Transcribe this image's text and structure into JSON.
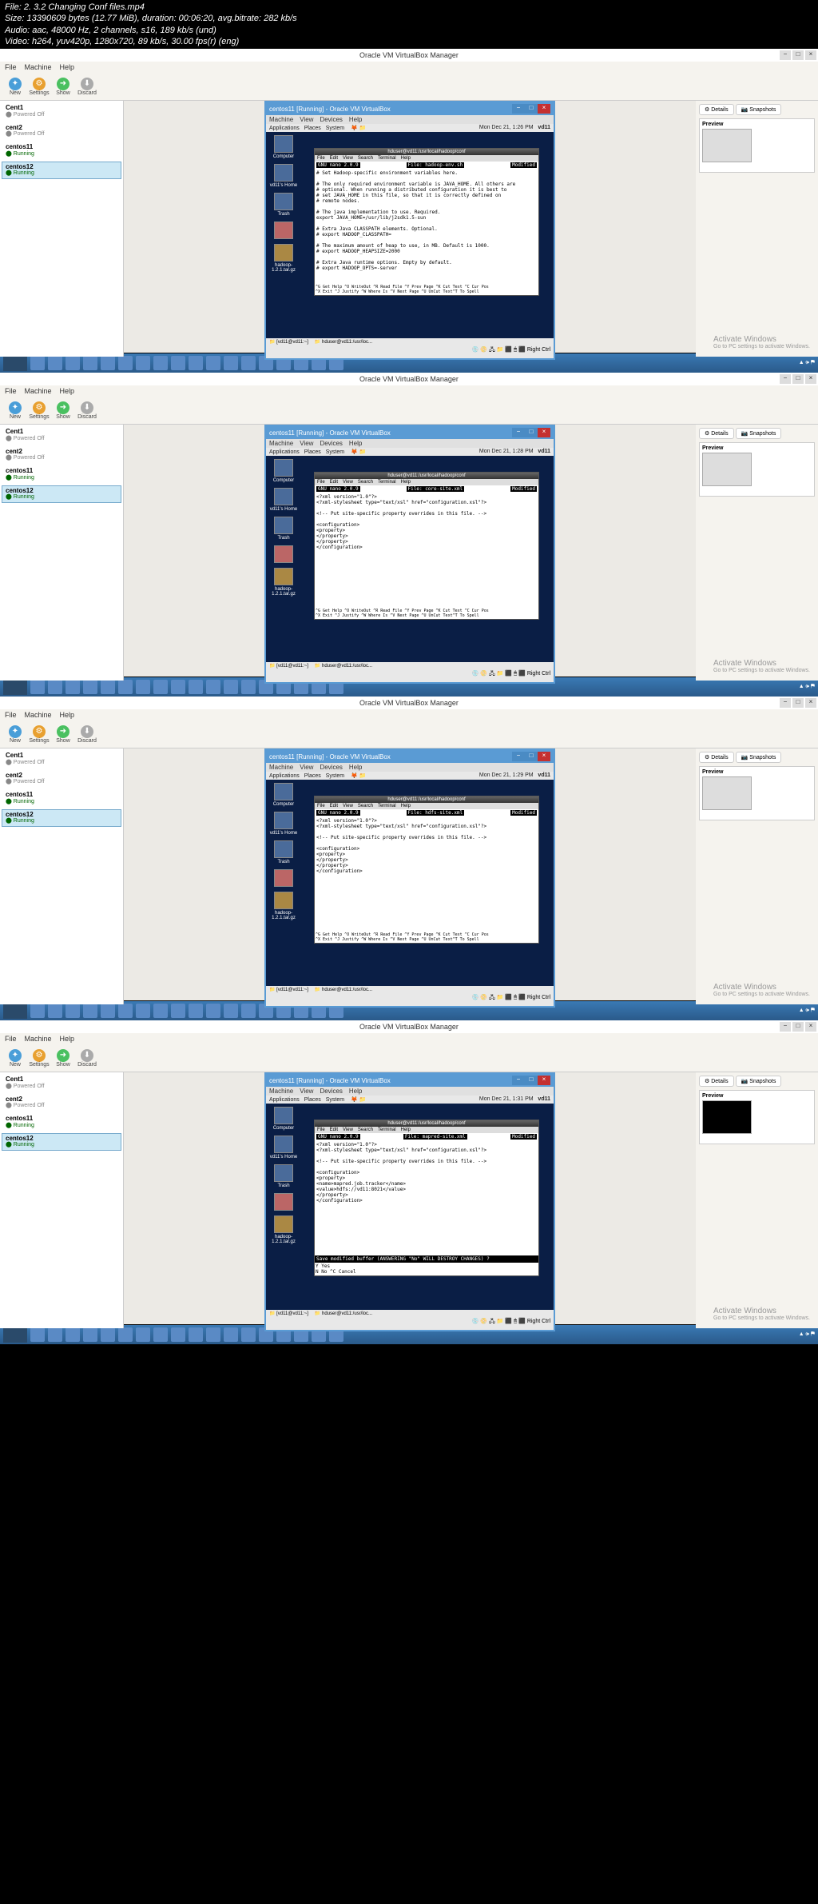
{
  "meta": {
    "file": "File: 2. 3.2 Changing Conf files.mp4",
    "size": "Size: 13390609 bytes (12.77 MiB), duration: 00:06:20, avg.bitrate: 282 kb/s",
    "audio": "Audio: aac, 48000 Hz, 2 channels, s16, 189 kb/s (und)",
    "video": "Video: h264, yuv420p, 1280x720, 89 kb/s, 30.00 fps(r) (eng)"
  },
  "vbox": {
    "title": "Oracle VM VirtualBox Manager",
    "menu": [
      "File",
      "Machine",
      "Help"
    ],
    "tools": {
      "new": "New",
      "settings": "Settings",
      "show": "Show",
      "discard": "Discard"
    },
    "tabs": {
      "details": "Details",
      "snapshots": "Snapshots"
    },
    "preview": "Preview",
    "vms": [
      {
        "name": "Cent1",
        "state": "Powered Off"
      },
      {
        "name": "cent2",
        "state": "Powered Off"
      },
      {
        "name": "centos11",
        "state": "Running"
      },
      {
        "name": "centos12",
        "state": "Running"
      }
    ]
  },
  "guest": {
    "menu": [
      "Machine",
      "View",
      "Devices",
      "Help"
    ],
    "gnome_menu": [
      "Applications",
      "Places",
      "System"
    ],
    "user": "vd11",
    "icons": {
      "computer": "Computer",
      "home": "vd11's Home",
      "trash": "Trash",
      "hadoop": "hadoop-1.2.1.tar.gz"
    },
    "term_menu": [
      "File",
      "Edit",
      "View",
      "Search",
      "Terminal",
      "Help"
    ],
    "nano_ver": "GNU nano 2.0.9",
    "modified": "Modified",
    "task1": "[vd11@vd11:~]",
    "task2": "hduser@vd11:/usr/loc...",
    "statusbar": "Right Ctrl"
  },
  "shots": [
    {
      "title": "centos11 [Running] - Oracle VM VirtualBox",
      "time": "Mon Dec 21, 1:26 PM",
      "term_title": "hduser@vd11:/usr/local/hadoop/conf",
      "nano_file": "File: hadoop-env.sh",
      "content": "# Set Hadoop-specific environment variables here.\n\n# The only required environment variable is JAVA_HOME. All others are\n# optional. When running a distributed configuration it is best to\n# set JAVA_HOME in this file, so that it is correctly defined on\n# remote nodes.\n\n# The java implementation to use. Required.\nexport JAVA_HOME=/usr/lib/j2sdk1.5-sun\n\n# Extra Java CLASSPATH elements. Optional.\n# export HADOOP_CLASSPATH=\n\n# The maximum amount of heap to use, in MB. Default is 1000.\n# export HADOOP_HEAPSIZE=2000\n\n# Extra Java runtime options. Empty by default.\n# export HADOOP_OPTS=-server"
    },
    {
      "title": "centos11 [Running] - Oracle VM VirtualBox",
      "time": "Mon Dec 21, 1:28 PM",
      "term_title": "hduser@vd11:/usr/local/hadoop/conf",
      "nano_file": "File: core-site.xml",
      "content": "<?xml version=\"1.0\"?>\n<?xml-stylesheet type=\"text/xsl\" href=\"configuration.xsl\"?>\n\n<!-- Put site-specific property overrides in this file. -->\n\n<configuration>\n<property>\n</property>\n</property>\n</configuration>"
    },
    {
      "title": "centos11 [Running] - Oracle VM VirtualBox",
      "time": "Mon Dec 21, 1:29 PM",
      "term_title": "hduser@vd11:/usr/local/hadoop/conf",
      "nano_file": "File: hdfs-site.xml",
      "content": "<?xml version=\"1.0\"?>\n<?xml-stylesheet type=\"text/xsl\" href=\"configuration.xsl\"?>\n\n<!-- Put site-specific property overrides in this file. -->\n\n<configuration>\n<property>\n</property>\n</property>\n</configuration>"
    },
    {
      "title": "centos11 [Running] - Oracle VM VirtualBox",
      "time": "Mon Dec 21, 1:31 PM",
      "term_title": "hduser@vd11:/usr/local/hadoop/conf",
      "nano_file": "File: mapred-site.xml",
      "content": "<?xml version=\"1.0\"?>\n<?xml-stylesheet type=\"text/xsl\" href=\"configuration.xsl\"?>\n\n<!-- Put site-specific property overrides in this file. -->\n\n<configuration>\n<property>\n<name>mapred.job.tracker</name>\n<value>hdfs://vd11:8021</value>\n</property>\n</configuration>",
      "save_prompt": "Save modified buffer (ANSWERING \"No\" WILL DESTROY CHANGES) ?",
      "save_yes": " Y Yes",
      "save_no": " N No         ^C Cancel",
      "preview_black": true
    }
  ],
  "nano_help": {
    "l1": "^G Get Help  ^O WriteOut  ^R Read File ^Y Prev Page ^K Cut Text  ^C Cur Pos",
    "l2": "^X Exit      ^J Justify   ^W Where Is  ^V Next Page ^U UnCut Text^T To Spell"
  },
  "watermark": {
    "title": "Activate Windows",
    "sub": "Go to PC settings to activate Windows."
  }
}
